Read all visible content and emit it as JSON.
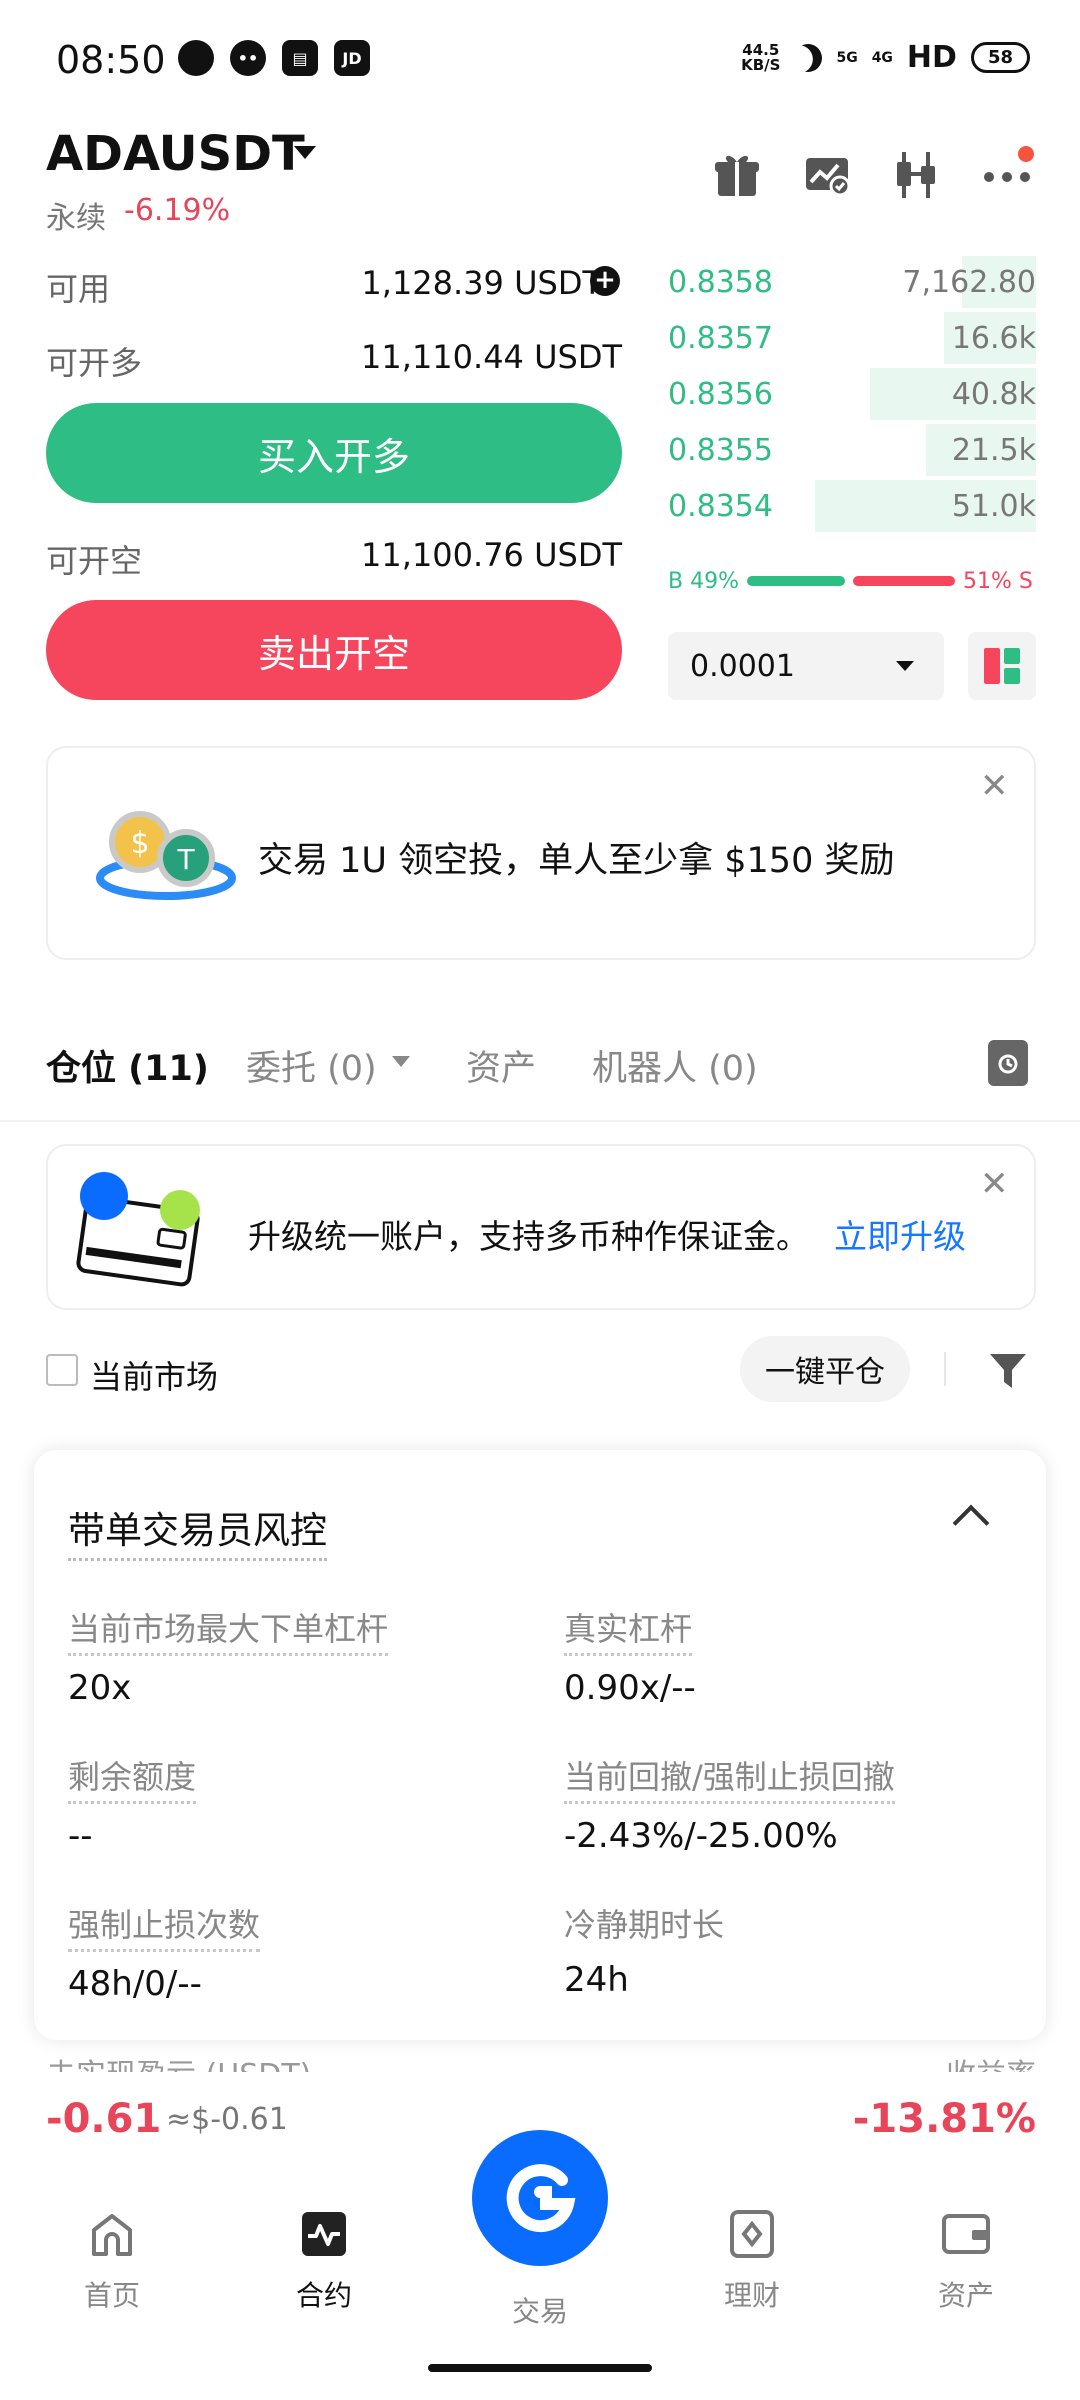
{
  "status_bar": {
    "time": "08:50",
    "app_icons": [
      "chat-bubble-icon",
      "message-icon",
      "news-icon",
      "JD"
    ],
    "net_speed_top": "44.5",
    "net_speed_bottom": "KB/S",
    "signal_1": "5G",
    "signal_2": "4G",
    "hd": "HD",
    "battery": "58"
  },
  "header": {
    "pair": "ADAUSDT",
    "contract_type": "永续",
    "change": "-6.19%",
    "icons": [
      "gift-icon",
      "chart-check-icon",
      "candlestick-icon",
      "more-icon"
    ]
  },
  "trade": {
    "available_label": "可用",
    "available_value": "1,128.39 USDT",
    "long_label": "可开多",
    "long_value": "11,110.44 USDT",
    "buy_button": "买入开多",
    "short_label": "可开空",
    "short_value": "11,100.76 USDT",
    "sell_button": "卖出开空"
  },
  "orderbook": {
    "rows": [
      {
        "price": "0.8358",
        "qty": "7,162.80",
        "depth": 0.2
      },
      {
        "price": "0.8357",
        "qty": "16.6k",
        "depth": 0.25
      },
      {
        "price": "0.8356",
        "qty": "40.8k",
        "depth": 0.45
      },
      {
        "price": "0.8355",
        "qty": "21.5k",
        "depth": 0.3
      },
      {
        "price": "0.8354",
        "qty": "51.0k",
        "depth": 0.6
      }
    ],
    "buy_ratio_label": "B 49%",
    "sell_ratio_label": "51% S",
    "buy_ratio": 0.49,
    "precision": "0.0001"
  },
  "airdrop_banner": {
    "text": "交易 1U 领空投，单人至少拿 $150 奖励"
  },
  "tabs": {
    "positions": "仓位 (11)",
    "orders": "委托 (0)",
    "assets": "资产",
    "bots": "机器人 (0)"
  },
  "upgrade_banner": {
    "text": "升级统一账户，支持多币种作保证金。",
    "link": "立即升级"
  },
  "filter": {
    "current_market": "当前市场",
    "close_all": "一键平仓"
  },
  "risk_card": {
    "title": "带单交易员风控",
    "max_leverage_label": "当前市场最大下单杠杆",
    "max_leverage_value": "20x",
    "real_leverage_label": "真实杠杆",
    "real_leverage_value": "0.90x/--",
    "remaining_quota_label": "剩余额度",
    "remaining_quota_value": "--",
    "drawdown_label": "当前回撤/强制止损回撤",
    "drawdown_value": "-2.43%/-25.00%",
    "forced_stop_label": "强制止损次数",
    "forced_stop_value": "48h/0/--",
    "cooldown_label": "冷静期时长",
    "cooldown_value": "24h"
  },
  "position_summary": {
    "pnl_label": "未实现盈亏 (USDT)",
    "roe_label": "收益率",
    "pnl_value": "-0.61",
    "pnl_usd": "≈$-0.61",
    "roe_value": "-13.81%"
  },
  "bottom_nav": {
    "home": "首页",
    "futures": "合约",
    "trade": "交易",
    "earn": "理财",
    "assets": "资产"
  }
}
